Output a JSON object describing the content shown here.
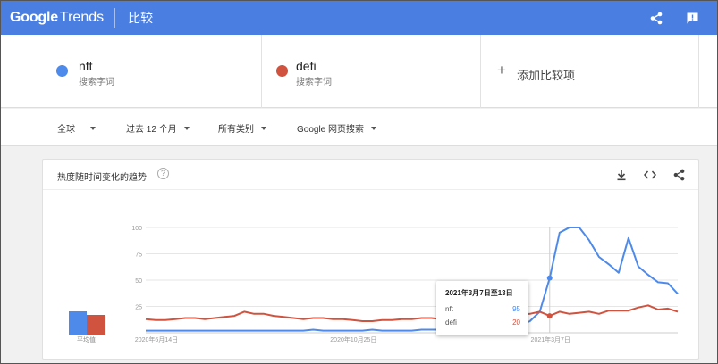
{
  "app": {
    "logo_google": "Google",
    "logo_trends": "Trends",
    "page_title": "比较"
  },
  "colors": {
    "nft": "#4d8ae9",
    "defi": "#d0533f",
    "topbar": "#4a7fe1"
  },
  "terms": [
    {
      "name": "nft",
      "subtitle": "搜索字词"
    },
    {
      "name": "defi",
      "subtitle": "搜索字词"
    }
  ],
  "add_compare": {
    "label": "添加比较项"
  },
  "filters": {
    "region": "全球",
    "time": "过去 12 个月",
    "category": "所有类别",
    "search_type": "Google 网页搜索"
  },
  "card": {
    "title": "热度随时间变化的趋势",
    "avg_label": "平均值"
  },
  "avg_values": {
    "nft": 12,
    "defi": 10
  },
  "tooltip": {
    "title": "2021年3月7日至13日",
    "rows": [
      {
        "term": "nft",
        "value": "95"
      },
      {
        "term": "defi",
        "value": "20"
      }
    ]
  },
  "chart_data": {
    "type": "line",
    "ylim": [
      0,
      100
    ],
    "y_ticks": [
      "25",
      "50",
      "75",
      "100"
    ],
    "x_tick_labels": [
      "2020年6月14日",
      "2020年10月25日",
      "2021年3月7日"
    ],
    "series": [
      {
        "name": "nft",
        "values": [
          2,
          2,
          2,
          2,
          2,
          2,
          2,
          2,
          2,
          2,
          2,
          2,
          2,
          2,
          2,
          2,
          2,
          3,
          2,
          2,
          2,
          2,
          2,
          3,
          2,
          2,
          2,
          2,
          3,
          3,
          3,
          3,
          3,
          3,
          3,
          3,
          4,
          5,
          7,
          11,
          20,
          52,
          95,
          100,
          100,
          88,
          72,
          65,
          57,
          90,
          63,
          55,
          48,
          47,
          37
        ]
      },
      {
        "name": "defi",
        "values": [
          13,
          12,
          12,
          13,
          14,
          14,
          13,
          14,
          15,
          16,
          20,
          18,
          18,
          16,
          15,
          14,
          13,
          14,
          14,
          13,
          13,
          12,
          11,
          11,
          12,
          12,
          13,
          13,
          14,
          14,
          13,
          14,
          14,
          14,
          15,
          14,
          16,
          18,
          17,
          18,
          20,
          16,
          20,
          18,
          19,
          20,
          18,
          21,
          21,
          21,
          24,
          26,
          22,
          23,
          20
        ]
      }
    ]
  }
}
